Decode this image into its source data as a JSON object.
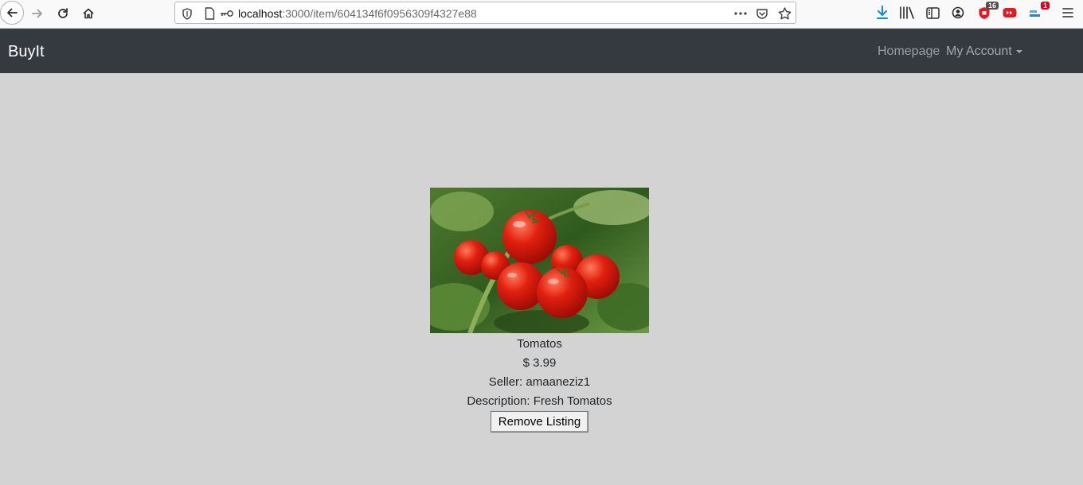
{
  "browser": {
    "url_host": "localhost",
    "url_rest": ":3000/item/604134f6f0956309f4327e88",
    "badges": {
      "ublock_count": "16",
      "extension_count": "1"
    },
    "icons": [
      "back-icon",
      "forward-icon",
      "reload-icon",
      "home-icon",
      "shield-icon",
      "page-icon",
      "key-icon",
      "more-icon",
      "pocket-icon",
      "star-icon",
      "download-icon",
      "library-icon",
      "sidebar-icon",
      "account-icon",
      "ublock-icon",
      "youtube-icon",
      "extension-icon",
      "menu-icon"
    ]
  },
  "navbar": {
    "brand": "BuyIt",
    "homepage": "Homepage",
    "my_account": "My Account",
    "background": "#343a40"
  },
  "item": {
    "name": "Tomatos",
    "price": "$ 3.99",
    "seller": "Seller: amaaneziz1",
    "description": "Description: Fresh Tomatos",
    "remove_button": "Remove Listing",
    "image_alt": "tomatoes-photo"
  },
  "page": {
    "background": "#d3d3d3"
  }
}
